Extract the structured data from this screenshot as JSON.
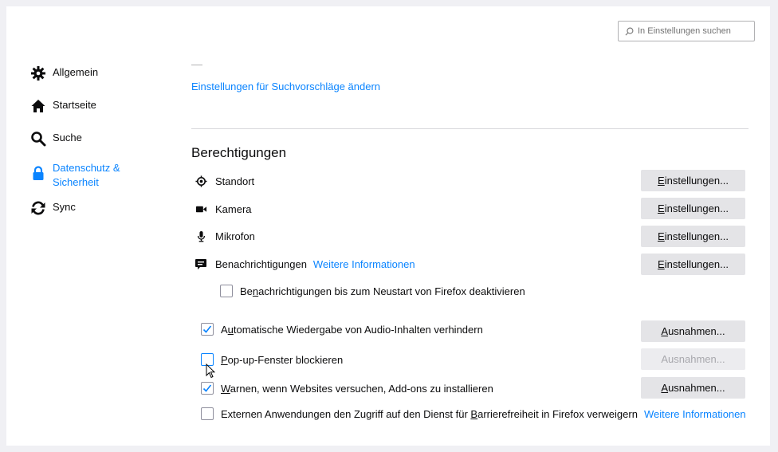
{
  "search": {
    "placeholder": "In Einstellungen suchen"
  },
  "sidebar": {
    "items": [
      {
        "label": "Allgemein",
        "icon": "gear-icon"
      },
      {
        "label": "Startseite",
        "icon": "home-icon"
      },
      {
        "label": "Suche",
        "icon": "search-icon"
      },
      {
        "label": "Datenschutz & Sicherheit",
        "line1": "Datenschutz &",
        "line2": "Sicherheit",
        "icon": "lock-icon",
        "selected": true
      },
      {
        "label": "Sync",
        "icon": "sync-icon"
      }
    ]
  },
  "main": {
    "suggest_link": "Einstellungen für Suchvorschläge ändern",
    "permissions": {
      "title": "Berechtigungen",
      "rows": [
        {
          "label": "Standort",
          "icon": "location-icon",
          "button": "Einstellungen..."
        },
        {
          "label": "Kamera",
          "icon": "camera-icon",
          "button": "Einstellungen..."
        },
        {
          "label": "Mikrofon",
          "icon": "microphone-icon",
          "button": "Einstellungen..."
        },
        {
          "label": "Benachrichtigungen",
          "icon": "notification-icon",
          "button": "Einstellungen...",
          "link": "Weitere Informationen"
        }
      ],
      "notifications_pause": {
        "label": "Benachrichtigungen bis zum Neustart von Firefox deaktivieren",
        "checked": false
      },
      "checks": [
        {
          "label": "Automatische Wiedergabe von Audio-Inhalten verhindern",
          "checked": true,
          "button": "Ausnahmen...",
          "button_disabled": false
        },
        {
          "label": "Pop-up-Fenster blockieren",
          "checked": false,
          "button": "Ausnahmen...",
          "button_disabled": true
        },
        {
          "label": "Warnen, wenn Websites versuchen, Add-ons zu installieren",
          "checked": true,
          "button": "Ausnahmen...",
          "button_disabled": false
        },
        {
          "label": "Externen Anwendungen den Zugriff auf den Dienst für Barrierefreiheit in Firefox verweigern",
          "checked": false,
          "link": "Weitere Informationen"
        }
      ]
    }
  },
  "colors": {
    "accent": "#0a84ff",
    "button_bg": "#e4e4e7",
    "page_bg": "#f0f0f4"
  }
}
